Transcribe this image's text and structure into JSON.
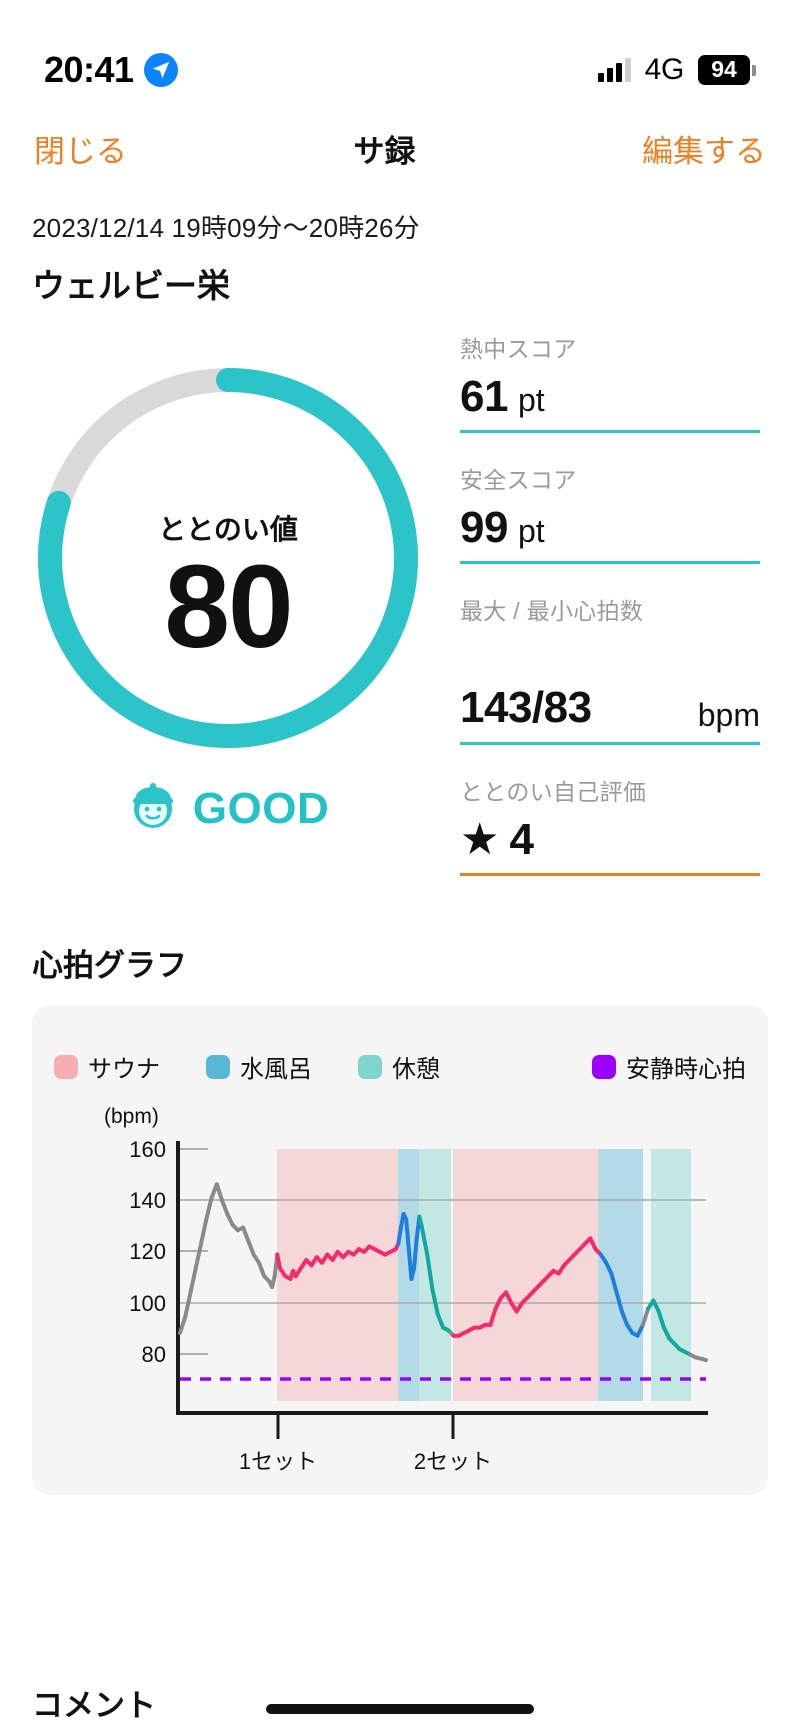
{
  "status_bar": {
    "time": "20:41",
    "location_icon": "location-arrow-icon",
    "signal_icon": "cellular-bars-icon",
    "network": "4G",
    "battery_level": "94"
  },
  "nav": {
    "close_label": "閉じる",
    "title": "サ録",
    "edit_label": "編集する",
    "accent_color": "#f07f23"
  },
  "session": {
    "datetime": "2023/12/14 19時09分〜20時26分",
    "venue": "ウェルビー栄"
  },
  "gauge": {
    "label": "ととのい値",
    "value": "80",
    "max": 100,
    "track_color": "#d9d9d9",
    "progress_color": "#2ac4c9",
    "rating_text": "GOOD",
    "rating_icon": "sauna-hat-face-icon",
    "rating_color": "#22c2c6"
  },
  "stats": [
    {
      "label": "熱中スコア",
      "value": "61",
      "unit": "pt",
      "rule_color": "#2ac4c9",
      "unit_align": "left"
    },
    {
      "label": "安全スコア",
      "value": "99",
      "unit": "pt",
      "rule_color": "#2ac4c9",
      "unit_align": "left"
    },
    {
      "label": "最大 / 最小心拍数",
      "value": "143/83",
      "unit": "bpm",
      "rule_color": "#2ac4c9",
      "unit_align": "right"
    },
    {
      "label": "ととのい自己評価",
      "value": "4",
      "unit": "",
      "star": "★",
      "rule_color": "#f07f23",
      "unit_align": "left"
    }
  ],
  "heart_rate": {
    "section_title": "心拍グラフ",
    "legend": [
      {
        "name": "サウナ",
        "color": "#f5afb0"
      },
      {
        "name": "水風呂",
        "color": "#58b7d4"
      },
      {
        "name": "休憩",
        "color": "#7fd6cc"
      },
      {
        "name": "安静時心拍",
        "color": "#9900ff"
      }
    ],
    "axis_unit": "(bpm)",
    "y_ticks": [
      "160",
      "140",
      "120",
      "100",
      "80"
    ],
    "x_ticks": [
      "1セット",
      "2セット"
    ]
  },
  "chart_data": {
    "type": "line",
    "title": "心拍グラフ",
    "xlabel": "",
    "ylabel": "(bpm)",
    "ylim": [
      70,
      168
    ],
    "yticks": [
      80,
      100,
      120,
      140,
      160
    ],
    "grid": true,
    "legend_position": "top",
    "resting_hr": 79,
    "resting_hr_label": "安静時心拍",
    "resting_hr_color": "#9900ff",
    "x_tick_labels": [
      "1セット",
      "2セット"
    ],
    "x_tick_positions": [
      0.185,
      0.52
    ],
    "phase_bands": [
      {
        "name": "サウナ",
        "color": "#f5afb0",
        "start": 0.185,
        "end": 0.415
      },
      {
        "name": "水風呂",
        "color": "#58b7d4",
        "start": 0.415,
        "end": 0.455
      },
      {
        "name": "休憩",
        "color": "#7fd6cc",
        "start": 0.455,
        "end": 0.515
      },
      {
        "name": "サウナ",
        "color": "#f5afb0",
        "start": 0.52,
        "end": 0.795
      },
      {
        "name": "水風呂",
        "color": "#58b7d4",
        "start": 0.795,
        "end": 0.88
      },
      {
        "name": "休憩",
        "color": "#7fd6cc",
        "start": 0.895,
        "end": 0.97
      }
    ],
    "series": [
      {
        "name": "心拍数",
        "segment_colors": {
          "idle": "#8a8a8a",
          "sauna": "#f5296e",
          "mizuburo": "#1f7fe0",
          "kyukei": "#12a8a0"
        },
        "x": [
          0.0,
          0.01,
          0.02,
          0.03,
          0.04,
          0.05,
          0.06,
          0.07,
          0.08,
          0.09,
          0.1,
          0.11,
          0.12,
          0.13,
          0.14,
          0.15,
          0.16,
          0.17,
          0.175,
          0.18,
          0.185,
          0.19,
          0.2,
          0.21,
          0.215,
          0.22,
          0.23,
          0.24,
          0.25,
          0.26,
          0.27,
          0.28,
          0.29,
          0.3,
          0.31,
          0.32,
          0.33,
          0.34,
          0.35,
          0.36,
          0.37,
          0.38,
          0.39,
          0.4,
          0.41,
          0.415,
          0.42,
          0.425,
          0.43,
          0.435,
          0.44,
          0.445,
          0.45,
          0.455,
          0.46,
          0.47,
          0.48,
          0.49,
          0.5,
          0.51,
          0.515,
          0.52,
          0.53,
          0.54,
          0.55,
          0.56,
          0.57,
          0.58,
          0.59,
          0.6,
          0.61,
          0.62,
          0.63,
          0.64,
          0.65,
          0.66,
          0.67,
          0.68,
          0.69,
          0.7,
          0.71,
          0.72,
          0.73,
          0.74,
          0.75,
          0.76,
          0.77,
          0.78,
          0.79,
          0.8,
          0.81,
          0.82,
          0.83,
          0.84,
          0.85,
          0.86,
          0.87,
          0.88,
          0.89,
          0.9,
          0.91,
          0.92,
          0.93,
          0.94,
          0.95,
          0.96,
          0.97,
          0.98,
          1.0
        ],
        "y": [
          97,
          103,
          112,
          121,
          130,
          139,
          147,
          152,
          146,
          141,
          137,
          135,
          136,
          131,
          126,
          123,
          118,
          116,
          114,
          118,
          126,
          121,
          118,
          117,
          120,
          118,
          121,
          124,
          122,
          125,
          123,
          126,
          124,
          127,
          125,
          127,
          126,
          128,
          127,
          129,
          128,
          127,
          126,
          127,
          128,
          130,
          136,
          141,
          139,
          128,
          117,
          121,
          132,
          140,
          136,
          126,
          113,
          104,
          99,
          98,
          97,
          96,
          96,
          97,
          98,
          99,
          99,
          100,
          100,
          106,
          110,
          112,
          108,
          105,
          108,
          110,
          112,
          114,
          116,
          118,
          120,
          119,
          122,
          124,
          126,
          128,
          130,
          132,
          128,
          126,
          123,
          119,
          112,
          105,
          100,
          97,
          96,
          100,
          106,
          109,
          105,
          99,
          95,
          93,
          91,
          90,
          89,
          88,
          87
        ]
      }
    ]
  },
  "footer": {
    "comment_label": "コメント"
  }
}
